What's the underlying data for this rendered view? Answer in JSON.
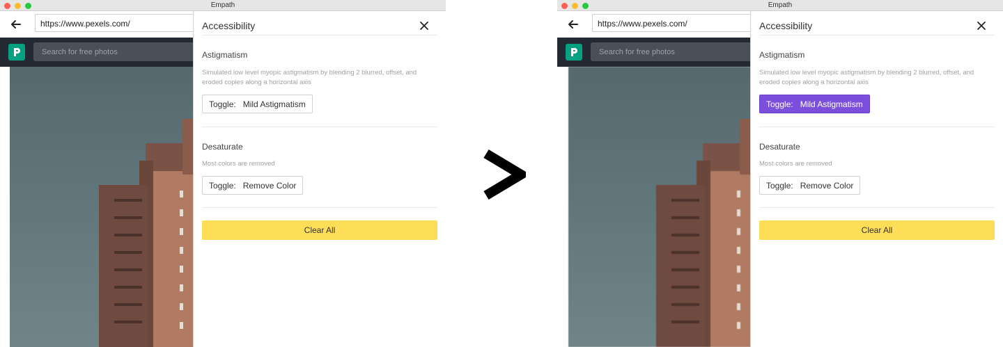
{
  "window_title": "Empath",
  "browser": {
    "url": "https://www.pexels.com/",
    "search_placeholder": "Search for free photos"
  },
  "panel": {
    "title": "Accessibility",
    "sections": [
      {
        "title": "Astigmatism",
        "description": "Simulated low level myopic astigmatism by blending 2 blurred, offset, and eroded copies along a horizontal axis",
        "toggle_prefix": "Toggle:",
        "toggle_label": "Mild Astigmatism"
      },
      {
        "title": "Desaturate",
        "description": "Most colors are removed",
        "toggle_prefix": "Toggle:",
        "toggle_label": "Remove Color"
      }
    ],
    "clear_all_label": "Clear All"
  },
  "states": {
    "before": {
      "mild_astigmatism_active": false
    },
    "after": {
      "mild_astigmatism_active": true
    }
  },
  "colors": {
    "active_toggle": "#7b4fdb",
    "clear_button": "#fede57",
    "site_header": "#232a34",
    "logo": "#05a081"
  },
  "icons": {
    "back": "arrow-left-icon",
    "close": "close-icon",
    "logo": "pexels-logo-icon",
    "transition": "chevron-right-icon"
  }
}
